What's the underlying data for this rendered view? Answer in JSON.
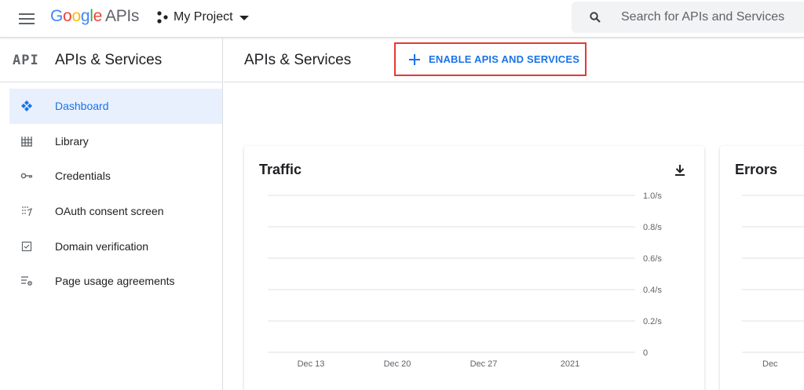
{
  "topbar": {
    "logo_letters": [
      "G",
      "o",
      "o",
      "g",
      "l",
      "e"
    ],
    "logo_suffix": "APIs",
    "project_name": "My Project",
    "search_placeholder": "Search for APIs and Services"
  },
  "sidebar": {
    "badge": "API",
    "title": "APIs & Services",
    "items": [
      {
        "label": "Dashboard",
        "icon": "dashboard-icon",
        "active": true
      },
      {
        "label": "Library",
        "icon": "library-icon",
        "active": false
      },
      {
        "label": "Credentials",
        "icon": "key-icon",
        "active": false
      },
      {
        "label": "OAuth consent screen",
        "icon": "oauth-icon",
        "active": false
      },
      {
        "label": "Domain verification",
        "icon": "checkbox-icon",
        "active": false
      },
      {
        "label": "Page usage agreements",
        "icon": "settings-list-icon",
        "active": false
      }
    ]
  },
  "main": {
    "title": "APIs & Services",
    "enable_button": "ENABLE APIS AND SERVICES"
  },
  "cards": {
    "traffic_title": "Traffic",
    "errors_title": "Errors",
    "errors_x_tick": "Dec"
  },
  "colors": {
    "accent": "#1a73e8",
    "highlight_border": "#e53935",
    "active_bg": "#e8f0fe"
  },
  "chart_data": {
    "type": "line",
    "title": "Traffic",
    "xlabel": "",
    "ylabel": "",
    "x_ticks": [
      "Dec 13",
      "Dec 20",
      "Dec 27",
      "2021"
    ],
    "y_ticks": [
      "1.0/s",
      "0.8/s",
      "0.6/s",
      "0.4/s",
      "0.2/s",
      "0"
    ],
    "y_values": [
      1.0,
      0.8,
      0.6,
      0.4,
      0.2,
      0
    ],
    "ylim": [
      0,
      1.0
    ],
    "series": [],
    "grid": true
  }
}
